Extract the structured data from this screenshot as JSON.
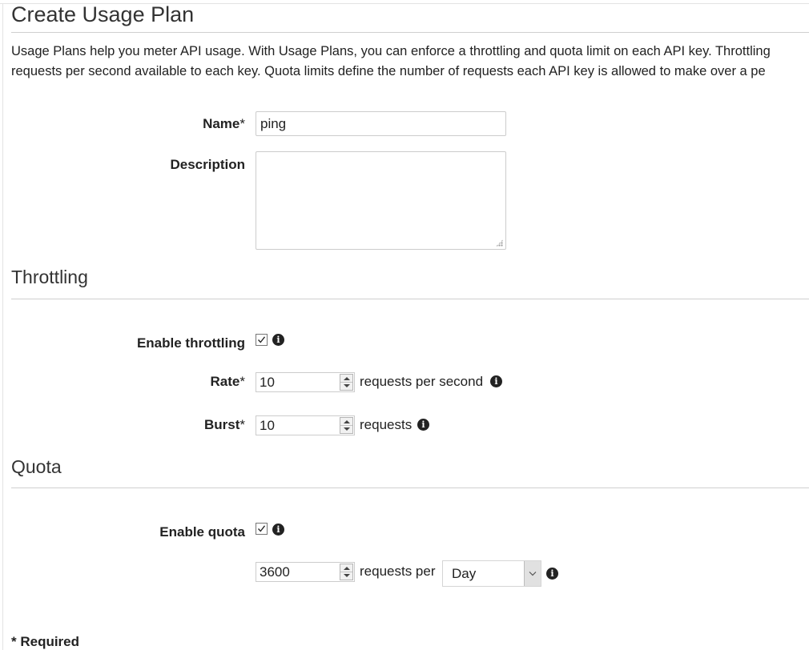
{
  "page": {
    "title": "Create Usage Plan",
    "intro_line1": "Usage Plans help you meter API usage. With Usage Plans, you can enforce a throttling and quota limit on each API key. Throttling",
    "intro_line2": "requests per second available to each key. Quota limits define the number of requests each API key is allowed to make over a pe"
  },
  "form": {
    "name_label": "Name",
    "name_value": "ping",
    "description_label": "Description",
    "description_value": ""
  },
  "throttling": {
    "section_title": "Throttling",
    "enable_label": "Enable throttling",
    "enabled": true,
    "rate_label": "Rate",
    "rate_value": "10",
    "rate_unit": "requests per second",
    "burst_label": "Burst",
    "burst_value": "10",
    "burst_unit": "requests"
  },
  "quota": {
    "section_title": "Quota",
    "enable_label": "Enable quota",
    "enabled": true,
    "limit_value": "3600",
    "limit_unit": "requests per",
    "period_selected": "Day"
  },
  "common": {
    "required_marker": "*",
    "required_note": "* Required"
  },
  "icons": {
    "info": "info-icon",
    "checkmark": "checkmark-icon",
    "dropdown": "chevron-down-icon",
    "spinner": "spinner-arrows-icon",
    "resize": "resize-grip-icon"
  }
}
